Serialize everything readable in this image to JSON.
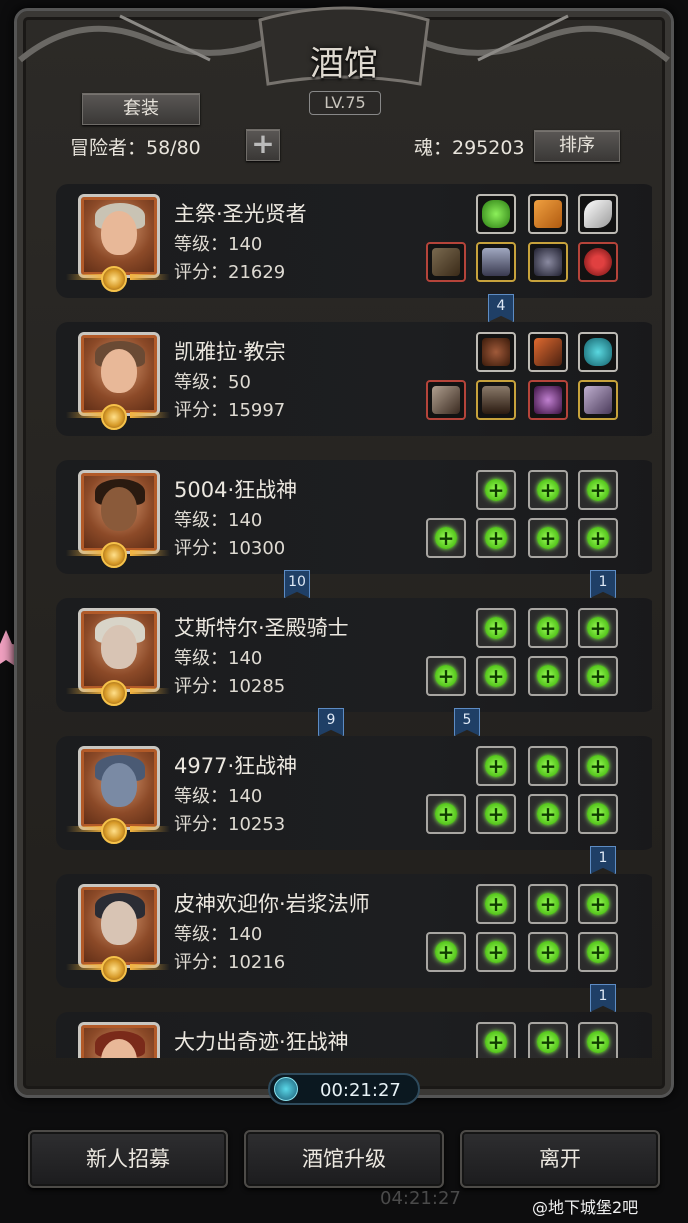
{
  "header": {
    "title": "酒馆",
    "level": "LV.75",
    "suit_label": "套装",
    "adventurer_text": "冒险者：58/80",
    "add_label": "+",
    "soul_text": "魂：295203",
    "sort_label": "排序"
  },
  "heroes": [
    {
      "name": "主祭·圣光贤者",
      "level": "等级：140",
      "score": "评分：21629"
    },
    {
      "name": "凯雅拉·教宗",
      "level": "等级：50",
      "score": "评分：15997"
    },
    {
      "name": "5004·狂战神",
      "level": "等级：140",
      "score": "评分：10300"
    },
    {
      "name": "艾斯特尔·圣殿骑士",
      "level": "等级：140",
      "score": "评分：10285"
    },
    {
      "name": "4977·狂战神",
      "level": "等级：140",
      "score": "评分：10253"
    },
    {
      "name": "皮神欢迎你·岩浆法师",
      "level": "等级：140",
      "score": "评分：10216"
    },
    {
      "name": "大力出奇迹·狂战神",
      "level": "",
      "score": ""
    }
  ],
  "links": [
    "4",
    "10",
    "1",
    "9",
    "5",
    "1",
    "1"
  ],
  "timer": "00:21:27",
  "footer": {
    "recruit": "新人招募",
    "upgrade": "酒馆升级",
    "leave": "离开"
  },
  "ghost_time": "04:21:27",
  "watermark": "@地下城堡2吧",
  "colors": {
    "empty_slot_plus": "#52c41a",
    "link_badge": "#1f3f66",
    "gold_frame": "#c7a23c"
  }
}
